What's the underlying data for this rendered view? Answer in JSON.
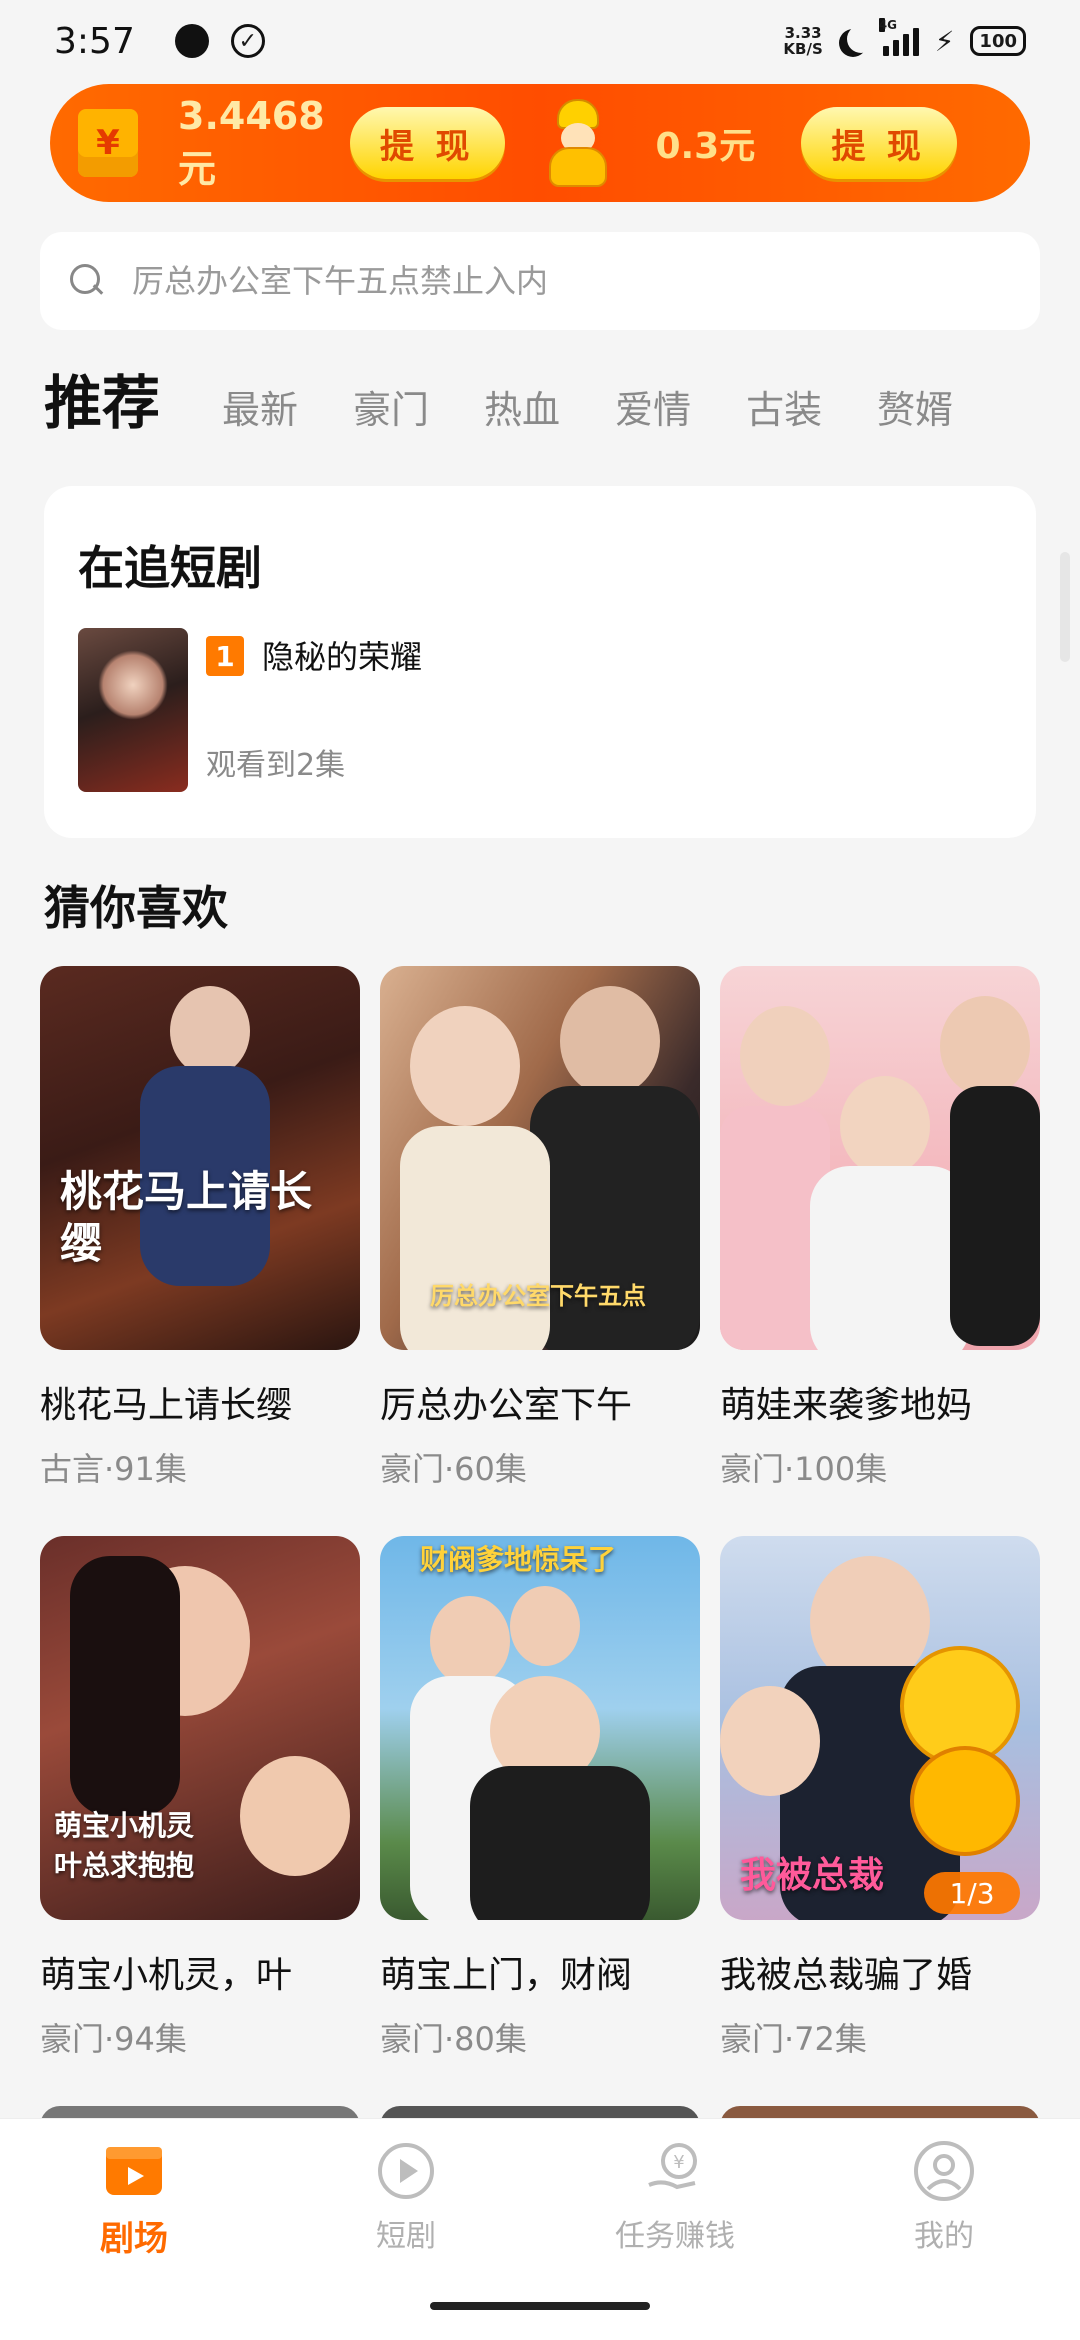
{
  "status_bar": {
    "time": "3:57",
    "net_speed_value": "3.33",
    "net_speed_unit": "KB/S",
    "network_type": "4G",
    "battery": "100"
  },
  "banner": {
    "amount_primary": "3.4468元",
    "withdraw_label_1": "提 现",
    "amount_secondary": "0.3元",
    "withdraw_label_2": "提 现"
  },
  "search": {
    "placeholder": "厉总办公室下午五点禁止入内"
  },
  "tabs": [
    "推荐",
    "最新",
    "豪门",
    "热血",
    "爱情",
    "古装",
    "赘婿"
  ],
  "following": {
    "title": "在追短剧",
    "item": {
      "rank": "1",
      "name": "隐秘的荣耀",
      "progress": "观看到2集"
    }
  },
  "recommend": {
    "title": "猜你喜欢",
    "items": [
      {
        "title": "桃花马上请长缨",
        "meta": "古言·91集",
        "caption": "桃花马上请长缨"
      },
      {
        "title": "厉总办公室下午",
        "meta": "豪门·60集",
        "caption": "厉总办公室下午五点"
      },
      {
        "title": "萌娃来袭爹地妈",
        "meta": "豪门·100集",
        "caption": ""
      },
      {
        "title": "萌宝小机灵，叶",
        "meta": "豪门·94集",
        "caption": "萌宝小机灵 叶总求抱抱"
      },
      {
        "title": "萌宝上门，财阀",
        "meta": "豪门·80集",
        "caption": "财阀爹地惊呆了"
      },
      {
        "title": "我被总裁骗了婚",
        "meta": "豪门·72集",
        "caption": "我被总裁",
        "badge": "1/3"
      }
    ]
  },
  "bottom_nav": [
    {
      "label": "剧场",
      "icon": "theater-icon",
      "active": true
    },
    {
      "label": "短剧",
      "icon": "play-circle-icon",
      "active": false
    },
    {
      "label": "任务赚钱",
      "icon": "coin-hand-icon",
      "active": false
    },
    {
      "label": "我的",
      "icon": "profile-icon",
      "active": false
    }
  ],
  "colors": {
    "accent": "#ff6a00",
    "badge": "#ff7a00",
    "background": "#f5f5f5"
  }
}
